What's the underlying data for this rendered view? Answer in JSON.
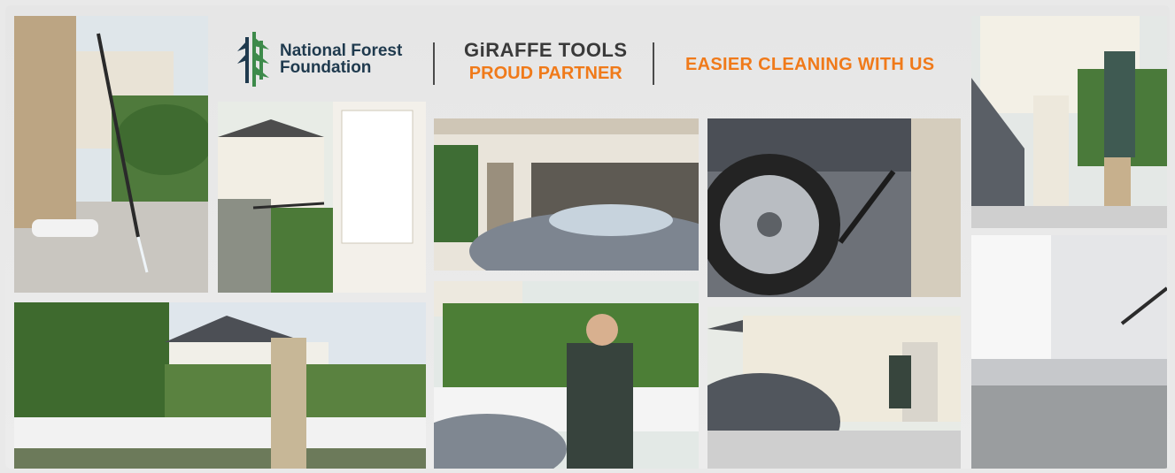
{
  "header": {
    "nff_line1": "National Forest",
    "nff_line2": "Foundation",
    "giraffe_brand": "GiRAFFE TOOLS",
    "giraffe_partner": "PROUD PARTNER",
    "tagline": "EASIER CLEANING WITH  US"
  },
  "colors": {
    "accent_orange": "#f07a1a",
    "nff_navy": "#1f3a4e",
    "nff_green": "#3d8a4a",
    "background": "#e9e9e9"
  },
  "photos": [
    "man-pressure-washing-patio",
    "man-washing-house-wall",
    "man-washing-car-in-garage",
    "washing-car-wheel-closeup",
    "man-washing-car-in-driveway",
    "man-washing-garden-path",
    "smiling-man-washing-car-by-hedge",
    "man-washing-car-near-house",
    "spraying-fence-base-closeup"
  ]
}
